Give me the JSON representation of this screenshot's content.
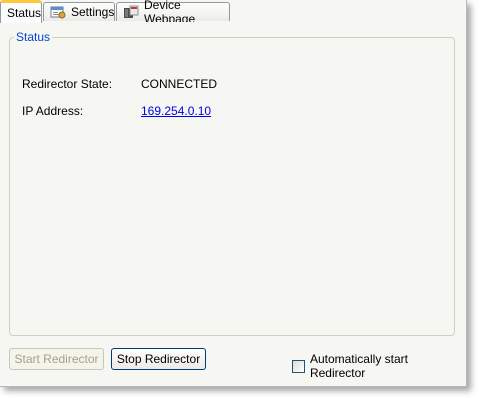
{
  "tabs": [
    {
      "label": "Status",
      "icon": null,
      "active": true
    },
    {
      "label": "Settings",
      "icon": "settings-window-icon",
      "active": false
    },
    {
      "label": "Device Webpage",
      "icon": "device-webpage-icon",
      "active": false
    }
  ],
  "status_group": {
    "legend": "Status",
    "redirector_state_label": "Redirector State:",
    "redirector_state_value": "CONNECTED",
    "ip_address_label": "IP Address:",
    "ip_address_value": "169.254.0.10"
  },
  "buttons": {
    "start": {
      "label": "Start Redirector",
      "enabled": false
    },
    "stop": {
      "label": "Stop Redirector",
      "enabled": true
    }
  },
  "auto_start": {
    "label": "Automatically start Redirector",
    "checked": false
  },
  "colors": {
    "active_tab_accent": "#ffc83c",
    "legend": "#0046d5",
    "link": "#0000ee"
  }
}
